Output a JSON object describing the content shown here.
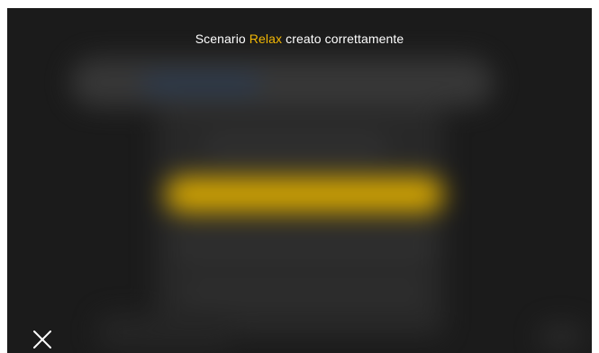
{
  "toast": {
    "prefix": "Scenario",
    "scenario_name": "Relax",
    "suffix": "creato correttamente"
  },
  "icons": {
    "close": "close-icon"
  },
  "colors": {
    "background": "#1b1b1b",
    "highlight": "#f2b705",
    "text": "#ffffff"
  }
}
